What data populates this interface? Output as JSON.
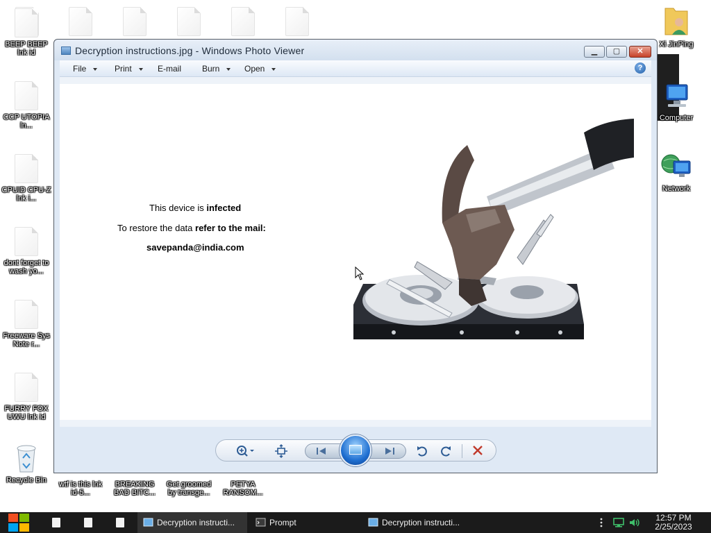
{
  "desktop": {
    "left_icons": [
      {
        "label": "BEEP BEEP lnk id",
        "icon": "file-icon"
      },
      {
        "label": "CCP UTOPIA ln...",
        "icon": "file-icon"
      },
      {
        "label": "CPUID CPU-Z lnk i...",
        "icon": "file-icon"
      },
      {
        "label": "dont forget to wash yo...",
        "icon": "file-icon"
      },
      {
        "label": "Freeware Sys Note r...",
        "icon": "file-icon"
      },
      {
        "label": "FURRY FOX UWU lnk id",
        "icon": "file-icon"
      },
      {
        "label": "Recycle Bin",
        "icon": "recycle-bin-icon"
      }
    ],
    "bottom_icons": [
      {
        "label": "wtf is this lnk id-5...",
        "icon": "file-icon"
      },
      {
        "label": "BREAKING BAD BITC...",
        "icon": "file-icon"
      },
      {
        "label": "Get groomed by transge...",
        "icon": "file-icon"
      },
      {
        "label": "PETYA RANSOM...",
        "icon": "file-icon"
      }
    ],
    "right_icons": [
      {
        "label": "Xi JinPing",
        "icon": "user-folder-icon"
      },
      {
        "label": "Computer",
        "icon": "computer-icon"
      },
      {
        "label": "Network",
        "icon": "network-icon"
      }
    ]
  },
  "window": {
    "title": "Decryption instructions.jpg - Windows Photo Viewer",
    "controls": {
      "minimize": "▁",
      "maximize": "▢",
      "close": "✕"
    },
    "menu": [
      {
        "label": "File",
        "has_dropdown": true
      },
      {
        "label": "Print",
        "has_dropdown": true
      },
      {
        "label": "E-mail",
        "has_dropdown": false
      },
      {
        "label": "Burn",
        "has_dropdown": true
      },
      {
        "label": "Open",
        "has_dropdown": true
      }
    ],
    "help": "?"
  },
  "image_content": {
    "line1_prefix": "This device is ",
    "line1_bold": "infected",
    "line2_prefix": "To restore the data ",
    "line2_bold": "refer to the mail:",
    "line3_bold": "savepanda@india.com"
  },
  "viewer_controls": [
    {
      "name": "zoom",
      "icon": "zoom-icon"
    },
    {
      "name": "fit-to-window",
      "icon": "fit-icon"
    },
    {
      "name": "previous",
      "icon": "previous-icon"
    },
    {
      "name": "slideshow",
      "icon": "slideshow-icon"
    },
    {
      "name": "next",
      "icon": "next-icon"
    },
    {
      "name": "rotate-counterclockwise",
      "icon": "rotate-left-icon"
    },
    {
      "name": "rotate-clockwise",
      "icon": "rotate-right-icon"
    },
    {
      "name": "delete",
      "icon": "delete-icon"
    }
  ],
  "taskbar": {
    "tasks": [
      {
        "label": "Decryption instructi...",
        "icon": "photo-viewer-icon",
        "active": true
      },
      {
        "label": "Prompt",
        "icon": "command-prompt-icon",
        "active": false
      },
      {
        "label": "Decryption instructi...",
        "icon": "photo-viewer-icon",
        "active": false
      }
    ],
    "clock_time": "12:57 PM",
    "clock_date": "2/25/2023"
  },
  "colors": {
    "window_frame": "#dfe9f5",
    "taskbar": "#1b1b1b",
    "delete_red": "#c0392b",
    "control_blue": "#2c5b94"
  }
}
